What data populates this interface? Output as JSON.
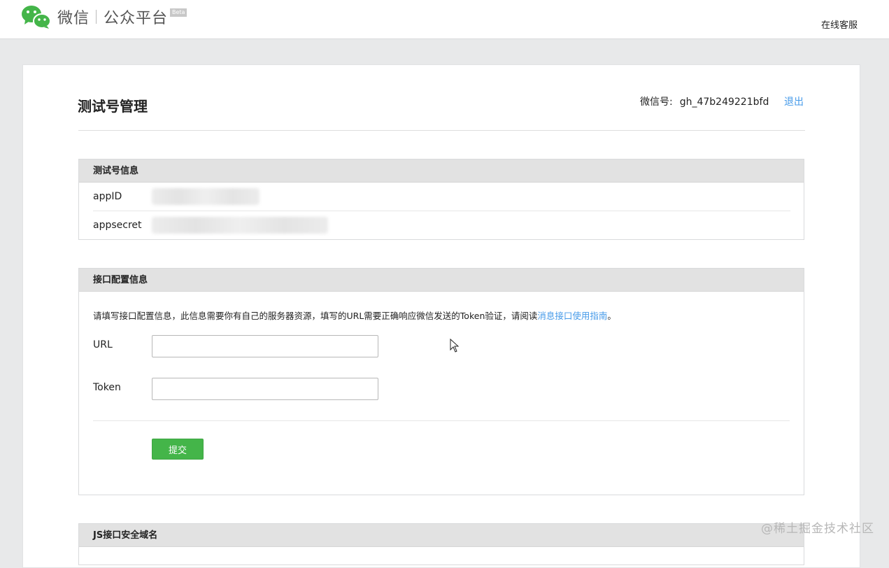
{
  "header": {
    "brand_wechat": "微信",
    "brand_platform": "公众平台",
    "beta_badge": "Beta",
    "online_service": "在线客服",
    "brand_color": "#44b549"
  },
  "page": {
    "title": "测试号管理",
    "account_label": "微信号:",
    "account_value": "gh_47b249221bfd",
    "logout_label": "退出"
  },
  "test_account_panel": {
    "title": "测试号信息",
    "rows": [
      {
        "label": "appID"
      },
      {
        "label": "appsecret"
      }
    ]
  },
  "interface_panel": {
    "title": "接口配置信息",
    "description": "请填写接口配置信息，此信息需要你有自己的服务器资源，填写的URL需要正确响应微信发送的Token验证，请阅读",
    "description_link": "消息接口使用指南",
    "description_end": "。",
    "url_label": "URL",
    "url_value": "",
    "token_label": "Token",
    "token_value": "",
    "submit_label": "提交"
  },
  "js_panel": {
    "title": "JS接口安全域名"
  },
  "watermark": "@稀土掘金技术社区",
  "link_color": "#459ae9"
}
